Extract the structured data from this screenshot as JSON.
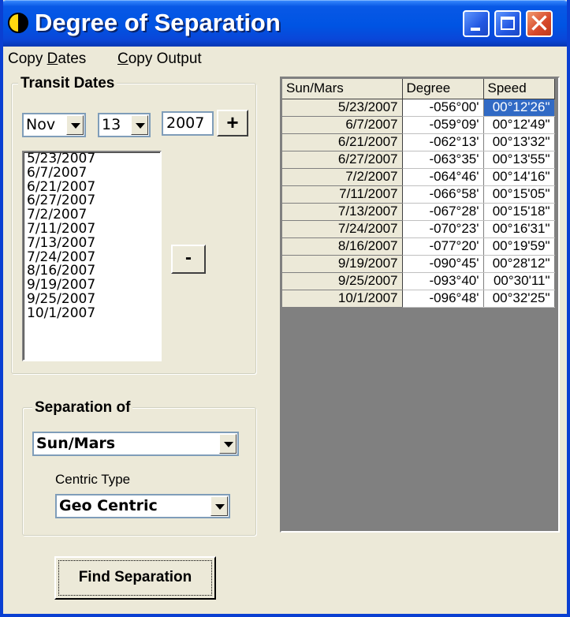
{
  "window": {
    "title": "Degree of Separation"
  },
  "menu": {
    "items": [
      "Copy Dates",
      "Copy Output"
    ]
  },
  "transit": {
    "legend": "Transit Dates",
    "month": "Nov",
    "day": "13",
    "year": "2007",
    "add_label": "+",
    "remove_label": "-",
    "dates": [
      "5/23/2007",
      "6/7/2007",
      "6/21/2007",
      "6/27/2007",
      "7/2/2007",
      "7/11/2007",
      "7/13/2007",
      "7/24/2007",
      "8/16/2007",
      "9/19/2007",
      "9/25/2007",
      "10/1/2007"
    ]
  },
  "separation": {
    "legend": "Separation of",
    "selected": "Sun/Mars",
    "centric_label": "Centric Type",
    "centric_selected": "Geo Centric"
  },
  "find_label": "Find Separation",
  "grid": {
    "headers": [
      "Sun/Mars",
      "Degree",
      "Speed"
    ],
    "rows": [
      [
        "5/23/2007",
        "-056°00'",
        "00°12'26\""
      ],
      [
        "6/7/2007",
        "-059°09'",
        "00°12'49\""
      ],
      [
        "6/21/2007",
        "-062°13'",
        "00°13'32\""
      ],
      [
        "6/27/2007",
        "-063°35'",
        "00°13'55\""
      ],
      [
        "7/2/2007",
        "-064°46'",
        "00°14'16\""
      ],
      [
        "7/11/2007",
        "-066°58'",
        "00°15'05\""
      ],
      [
        "7/13/2007",
        "-067°28'",
        "00°15'18\""
      ],
      [
        "7/24/2007",
        "-070°23'",
        "00°16'31\""
      ],
      [
        "8/16/2007",
        "-077°20'",
        "00°19'59\""
      ],
      [
        "9/19/2007",
        "-090°45'",
        "00°28'12\""
      ],
      [
        "9/25/2007",
        "-093°40'",
        "00°30'11\""
      ],
      [
        "10/1/2007",
        "-096°48'",
        "00°32'25\""
      ]
    ]
  },
  "colors": {
    "titlebar": "#0054e3",
    "selection": "#316ac5",
    "window": "#ece9d8"
  }
}
